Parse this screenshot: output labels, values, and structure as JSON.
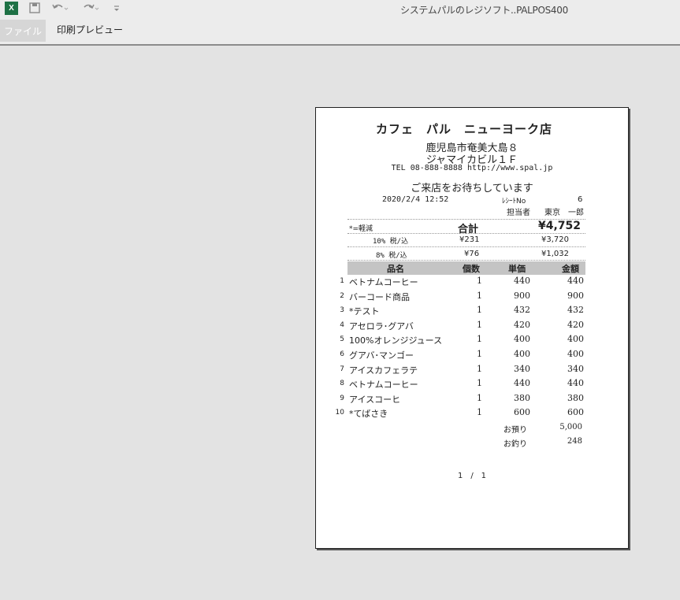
{
  "window": {
    "title": "システムパルのレジソフト..PALPOS400",
    "app_icon": "X"
  },
  "ribbon": {
    "file_tab": "ファイル",
    "preview_tab": "印刷プレビュー"
  },
  "receipt": {
    "store_name": "カフェ　パル　ニューヨーク店",
    "address_line1": "鹿児島市奄美大島８",
    "address_line2": "ジャマイカビル１Ｆ",
    "tel_line": "TEL 08-888-8888 http://www.spal.jp",
    "welcome": "ご来店をお待ちしています",
    "datetime": "2020/2/4 12:52",
    "receipt_no_label": "ﾚｼｰﾄNo",
    "receipt_no": "6",
    "clerk_label": "担当者",
    "clerk_name": "東京　一郎",
    "reduced_note": "*=軽減",
    "total_label": "合計",
    "total": "¥4,752",
    "tax": [
      {
        "label": "10% 税/込",
        "tax": "¥231",
        "amount": "¥3,720"
      },
      {
        "label": "8% 税/込",
        "tax": "¥76",
        "amount": "¥1,032"
      }
    ],
    "columns": {
      "name": "品名",
      "qty": "個数",
      "unit": "単価",
      "amount": "金額"
    },
    "items": [
      {
        "no": "1",
        "name": "ベトナムコーヒー",
        "qty": "1",
        "unit": "440",
        "amount": "440"
      },
      {
        "no": "2",
        "name": "バーコード商品",
        "qty": "1",
        "unit": "900",
        "amount": "900"
      },
      {
        "no": "3",
        "name": "*テスト",
        "qty": "1",
        "unit": "432",
        "amount": "432"
      },
      {
        "no": "4",
        "name": "アセロラ･グアバ",
        "qty": "1",
        "unit": "420",
        "amount": "420"
      },
      {
        "no": "5",
        "name": "100%オレンジジュース",
        "qty": "1",
        "unit": "400",
        "amount": "400"
      },
      {
        "no": "6",
        "name": "グアバ･マンゴー",
        "qty": "1",
        "unit": "400",
        "amount": "400"
      },
      {
        "no": "7",
        "name": "アイスカフェラテ",
        "qty": "1",
        "unit": "340",
        "amount": "340"
      },
      {
        "no": "8",
        "name": "ベトナムコーヒー",
        "qty": "1",
        "unit": "440",
        "amount": "440"
      },
      {
        "no": "9",
        "name": "アイスコーヒ",
        "qty": "1",
        "unit": "380",
        "amount": "380"
      },
      {
        "no": "10",
        "name": "*てばさき",
        "qty": "1",
        "unit": "600",
        "amount": "600"
      }
    ],
    "deposit_label": "お預り",
    "deposit": "5,000",
    "change_label": "お釣り",
    "change": "248",
    "page_indicator": "1　/　1"
  }
}
